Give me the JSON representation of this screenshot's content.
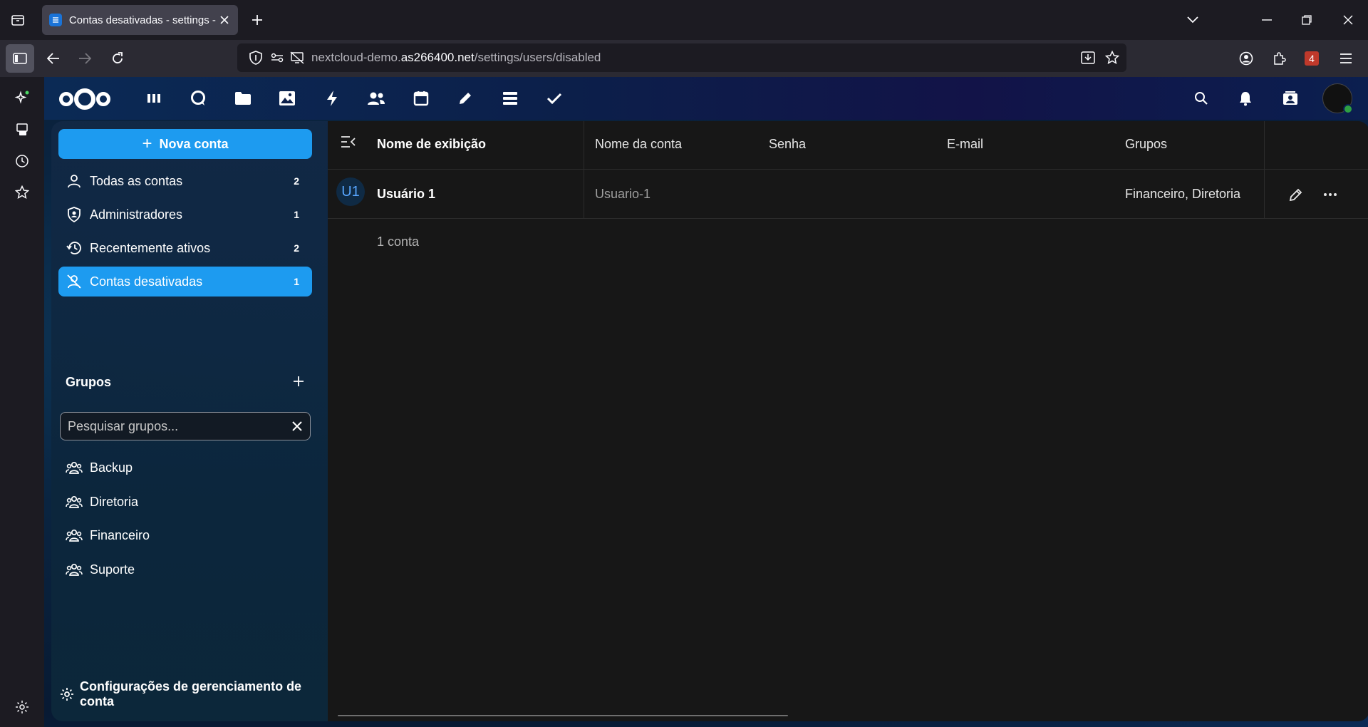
{
  "browser": {
    "tab_title": "Contas desativadas - settings - ",
    "url_prefix": "nextcloud-demo.",
    "url_domain": "as266400.net",
    "url_path": "/settings/users/disabled",
    "extension_badge": "4"
  },
  "header": {
    "apps": [
      "dashboard",
      "talk",
      "files",
      "photos",
      "activity",
      "contacts",
      "calendar",
      "notes",
      "deck",
      "tasks"
    ]
  },
  "nav": {
    "new_account_label": "Nova conta",
    "items": [
      {
        "label": "Todas as contas",
        "count": "2"
      },
      {
        "label": "Administradores",
        "count": "1"
      },
      {
        "label": "Recentemente ativos",
        "count": "2"
      },
      {
        "label": "Contas desativadas",
        "count": "1"
      }
    ],
    "groups_title": "Grupos",
    "group_search_placeholder": "Pesquisar grupos...",
    "groups": [
      {
        "label": "Backup"
      },
      {
        "label": "Diretoria"
      },
      {
        "label": "Financeiro"
      },
      {
        "label": "Suporte"
      }
    ],
    "account_settings_label": "Configurações de gerenciamento de conta"
  },
  "table": {
    "headers": {
      "display_name": "Nome de exibição",
      "account_name": "Nome da conta",
      "password": "Senha",
      "email": "E-mail",
      "groups": "Grupos"
    },
    "rows": [
      {
        "avatar": "U1",
        "display_name": "Usuário 1",
        "account_name": "Usuario-1",
        "password": "",
        "email": "",
        "groups": "Financeiro, Diretoria"
      }
    ],
    "footer": "1 conta"
  },
  "colors": {
    "accent": "#1d9bf0",
    "content_bg": "#171717"
  }
}
